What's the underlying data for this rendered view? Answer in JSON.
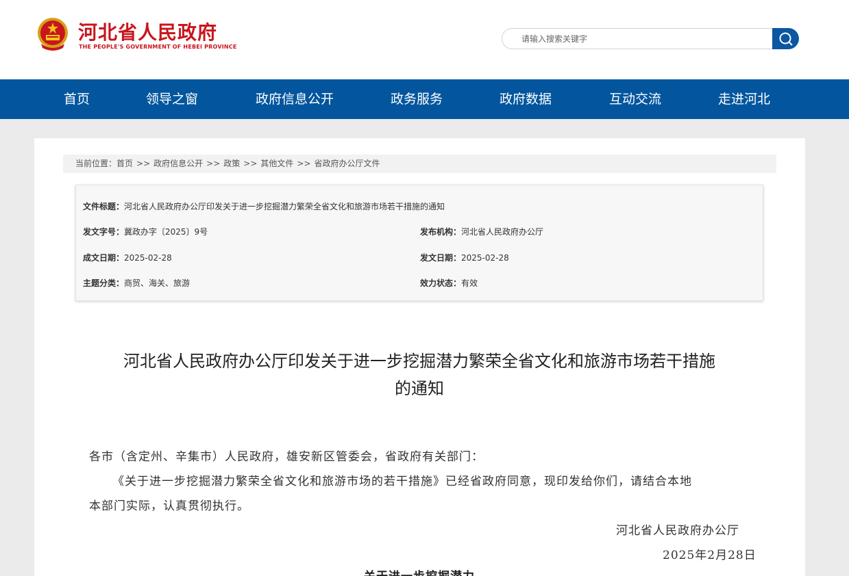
{
  "header": {
    "site_title": "河北省人民政府",
    "site_subtitle": "THE PEOPLE'S GOVERNMENT OF HEBEI PROVINCE",
    "search_placeholder": "请输入搜索关键字",
    "brand_color": "#c8161d"
  },
  "nav": {
    "color": "#03569e",
    "items": [
      {
        "label": "首页"
      },
      {
        "label": "领导之窗"
      },
      {
        "label": "政府信息公开"
      },
      {
        "label": "政务服务"
      },
      {
        "label": "政府数据"
      },
      {
        "label": "互动交流"
      },
      {
        "label": "走进河北"
      }
    ]
  },
  "breadcrumb": {
    "prefix": "当前位置：",
    "separator": ">>",
    "items": [
      "首页",
      "政府信息公开",
      "政策",
      "其他文件",
      "省政府办公厅文件"
    ]
  },
  "info": {
    "title_label": "文件标题：",
    "title_value": "河北省人民政府办公厅印发关于进一步挖掘潜力繁荣全省文化和旅游市场若干措施的通知",
    "docno_label": "发文字号：",
    "docno_value": "冀政办字〔2025〕9号",
    "issuer_label": "发布机构：",
    "issuer_value": "河北省人民政府办公厅",
    "created_label": "成文日期：",
    "created_value": "2025-02-28",
    "published_label": "发文日期：",
    "published_value": "2025-02-28",
    "topic_label": "主题分类：",
    "topic_value": "商贸、海关、旅游",
    "status_label": "效力状态：",
    "status_value": "有效"
  },
  "doc": {
    "title_line1": "河北省人民政府办公厅印发关于进一步挖掘潜力繁荣全省文化和旅游市场若干措施",
    "title_line2": "的通知",
    "salutation": "各市（含定州、辛集市）人民政府，雄安新区管委会，省政府有关部门：",
    "para1_line1": "《关于进一步挖掘潜力繁荣全省文化和旅游市场的若干措施》已经省政府同意，现印发给你们，请结合本地",
    "para1_line2": "本部门实际，认真贯彻执行。",
    "signature": "河北省人民政府办公厅",
    "date": "2025年2月28日",
    "attachment_title": "关于进一步挖掘潜力"
  }
}
